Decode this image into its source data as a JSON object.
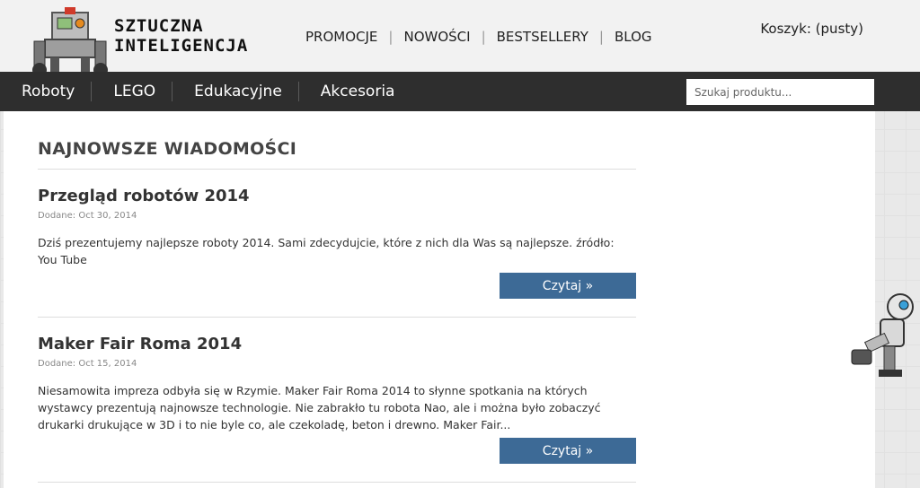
{
  "logo": {
    "line1": "SZTUCZNA",
    "line2": "INTELIGENCJA"
  },
  "top_nav": [
    "PROMOCJE",
    "NOWOŚCI",
    "BESTSELLERY",
    "BLOG"
  ],
  "cart": "Koszyk: (pusty)",
  "categories": [
    "Roboty",
    "LEGO",
    "Edukacyjne",
    "Akcesoria"
  ],
  "search": {
    "placeholder": "Szukaj produktu...",
    "value": ""
  },
  "section_title": "NAJNOWSZE WIADOMOŚCI",
  "posts": [
    {
      "title": "Przegląd robotów 2014",
      "date": "Dodane: Oct 30, 2014",
      "excerpt": "Dziś prezentujemy najlepsze roboty 2014. Sami zdecydujcie, które z nich dla Was są najlepsze.   źródło: You Tube",
      "button": "Czytaj »"
    },
    {
      "title": "Maker Fair Roma 2014",
      "date": "Dodane: Oct 15, 2014",
      "excerpt": "Niesamowita impreza odbyła się w Rzymie. Maker Fair Roma 2014 to słynne spotkania na których wystawcy prezentują najnowsze technologie. Nie zabrakło tu robota Nao, ale i można było zobaczyć drukarki drukujące w 3D i to nie byle co, ale czekoladę, beton i drewno. Maker Fair...",
      "button": "Czytaj »"
    }
  ],
  "colors": {
    "cat_bar": "#2e2e2e",
    "button": "#3d6a96"
  },
  "icons": {
    "logo_image": "lego-robot-icon",
    "side_image": "robot-arm-icon"
  }
}
